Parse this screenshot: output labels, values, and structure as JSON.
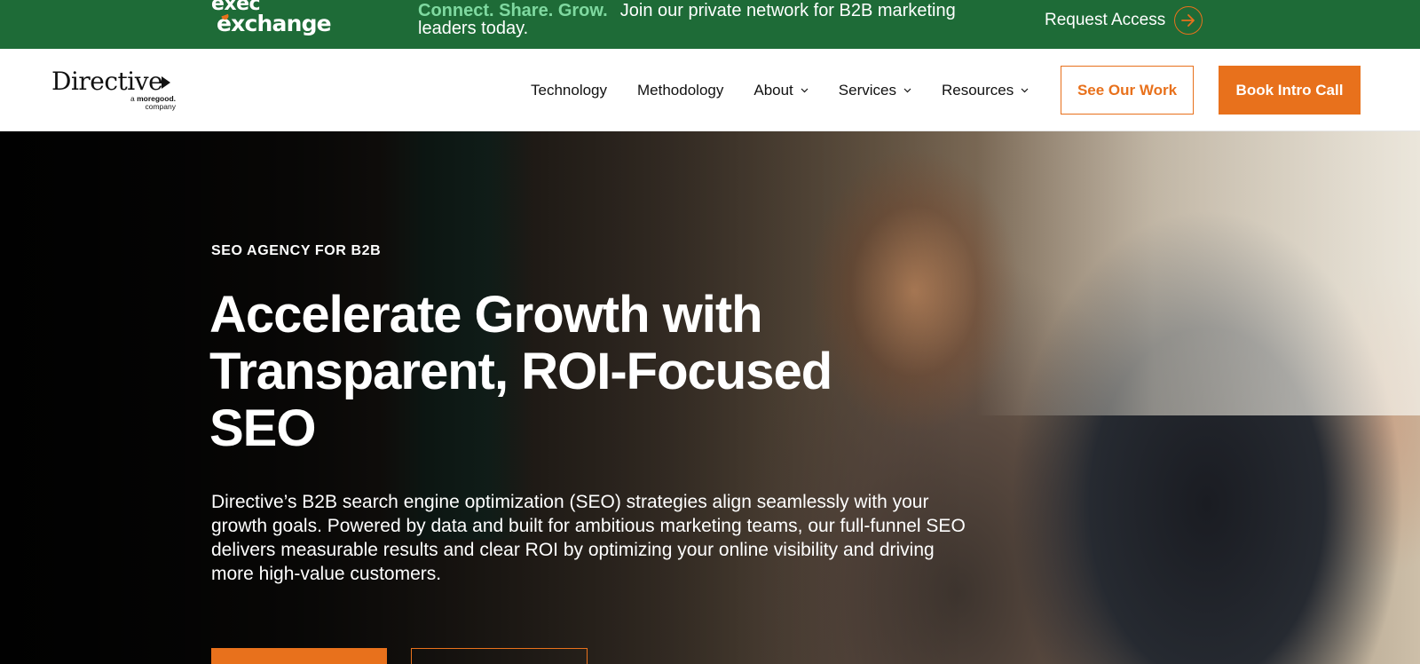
{
  "promo_banner": {
    "logo_line1": "exec",
    "logo_line2": "exchange",
    "tagline_accent": "Connect. Share. Grow.",
    "tagline": "Join our private network for B2B marketing leaders today.",
    "cta_label": "Request Access"
  },
  "nav": {
    "brand_name": "Directive",
    "brand_sub_prefix": "a",
    "brand_sub_name": "moregood.",
    "brand_sub_suffix": "company",
    "links": [
      {
        "label": "Technology",
        "has_dropdown": false
      },
      {
        "label": "Methodology",
        "has_dropdown": false
      },
      {
        "label": "About",
        "has_dropdown": true
      },
      {
        "label": "Services",
        "has_dropdown": true
      },
      {
        "label": "Resources",
        "has_dropdown": true
      }
    ],
    "see_work_label": "See Our Work",
    "book_call_label": "Book Intro Call"
  },
  "hero": {
    "eyebrow": "SEO AGENCY FOR B2B",
    "headline_bold": "Accelerate Growth",
    "headline_rest": " with Transparent, ROI-Focused SEO",
    "description": "Directive’s B2B search engine optimization (SEO) strategies align seamlessly with your growth goals. Powered by data and built for ambitious marketing teams, our full-funnel SEO delivers measurable results and clear ROI by optimizing your online visibility and driving more high-value customers."
  },
  "colors": {
    "banner_green": "#1e6b37",
    "banner_accent": "#7fd9a0",
    "brand_orange": "#e8711c",
    "text_dark": "#111111",
    "white": "#ffffff"
  },
  "icons": {
    "request_access": "arrow-right-circle-icon",
    "dropdown": "chevron-down-icon"
  }
}
